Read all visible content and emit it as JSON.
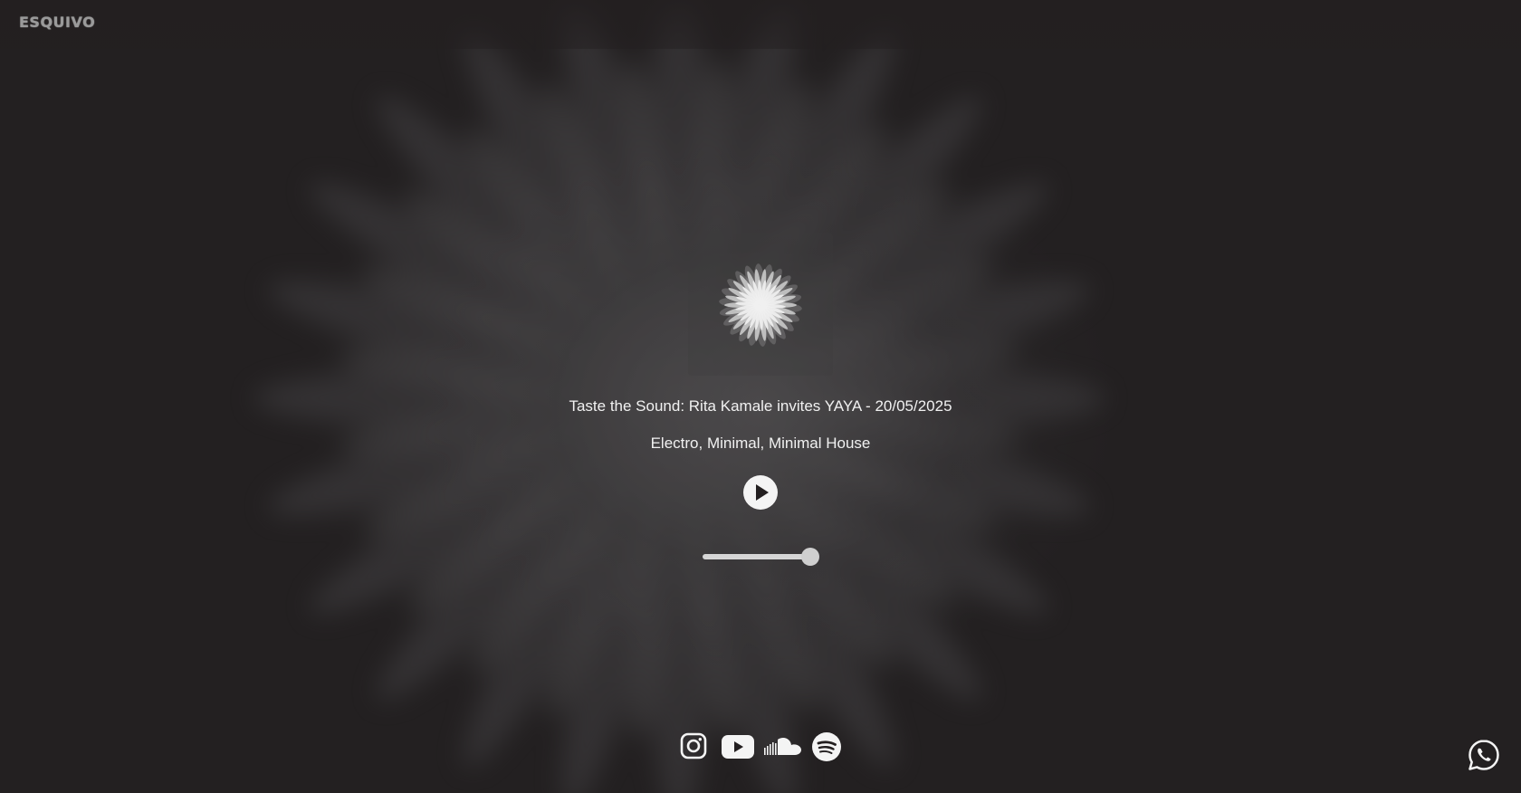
{
  "header": {
    "logo_text": "ESQUIVO"
  },
  "player": {
    "track_title": "Taste the Sound: Rita Kamale invites YAYA - 20/05/2025",
    "genres": "Electro, Minimal, Minimal House",
    "play_icon": "play-icon",
    "volume_level": 1.0
  },
  "socials": [
    {
      "name": "instagram-icon"
    },
    {
      "name": "youtube-icon"
    },
    {
      "name": "soundcloud-icon"
    },
    {
      "name": "spotify-icon"
    }
  ],
  "floating": {
    "whatsapp_icon": "whatsapp-icon"
  },
  "colors": {
    "background": "#231f20",
    "text": "#f1f1f1",
    "controls": "#f4f4f4"
  }
}
